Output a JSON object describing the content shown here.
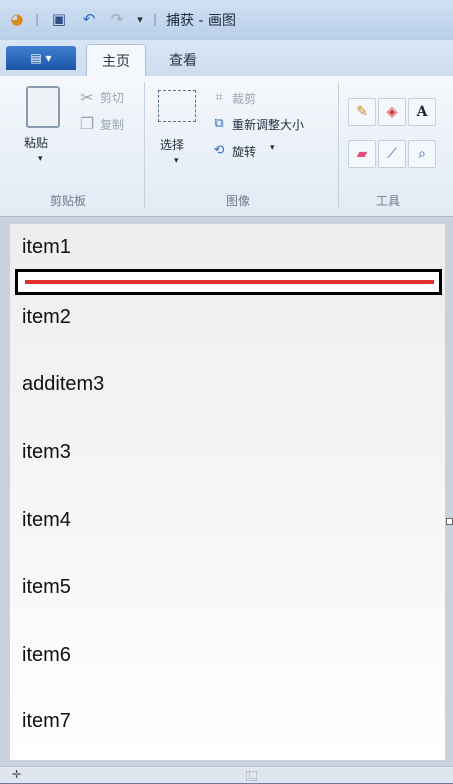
{
  "window": {
    "title": "捕获 - 画图"
  },
  "quick_access": {
    "app_icon": "paint-palette-icon",
    "save_icon": "save-icon",
    "undo_icon": "undo-icon",
    "redo_icon": "redo-icon",
    "customize_icon": "dropdown-arrow-icon"
  },
  "tabs": {
    "file_label": "▤ ▾",
    "home": "主页",
    "view": "查看"
  },
  "clipboard": {
    "paste": "粘贴",
    "cut": "剪切",
    "copy": "复制",
    "group": "剪贴板"
  },
  "image": {
    "select": "选择",
    "crop": "裁剪",
    "resize": "重新调整大小",
    "rotate": "旋转",
    "group": "图像"
  },
  "tools": {
    "group": "工具"
  },
  "canvas": {
    "items": [
      "item1",
      "item2",
      "additem3",
      "item3",
      "item4",
      "item5",
      "item6",
      "item7"
    ],
    "selection_line_color": "#e12e2e"
  },
  "status": {
    "left": "✛",
    "mid": "⿺"
  }
}
